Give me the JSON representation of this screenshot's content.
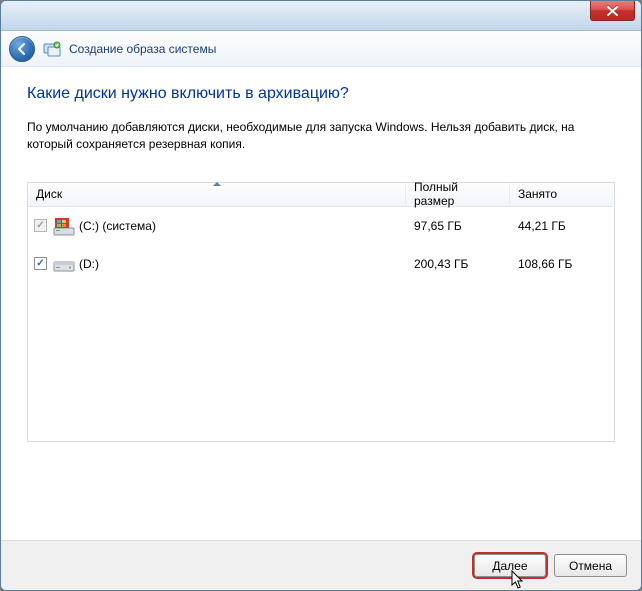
{
  "header": {
    "title": "Создание образа системы"
  },
  "section": {
    "title": "Какие диски нужно включить в архивацию?",
    "description": "По умолчанию добавляются диски, необходимые для запуска Windows. Нельзя добавить диск, на который сохраняется резервная копия."
  },
  "table": {
    "columns": {
      "disk": "Диск",
      "total": "Полный размер",
      "used": "Занято"
    },
    "rows": [
      {
        "name": "(C:) (система)",
        "total": "97,65 ГБ",
        "used": "44,21 ГБ",
        "checked": true,
        "disabled": true,
        "sys": true
      },
      {
        "name": "(D:)",
        "total": "200,43 ГБ",
        "used": "108,66 ГБ",
        "checked": true,
        "disabled": false,
        "sys": false
      }
    ]
  },
  "buttons": {
    "next": "Далее",
    "cancel": "Отмена"
  }
}
